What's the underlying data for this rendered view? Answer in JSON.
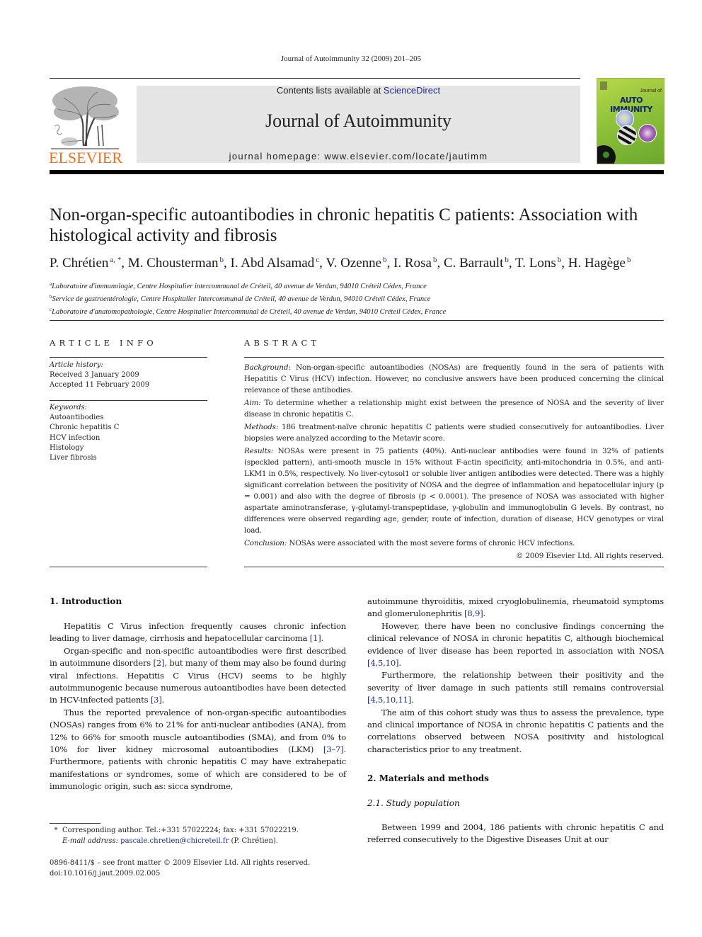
{
  "header": {
    "running_head": "Journal of Autoimmunity 32 (2009) 201–205",
    "contents_prefix": "Contents lists available at ",
    "contents_link": "ScienceDirect",
    "journal_name": "Journal of Autoimmunity",
    "homepage_prefix": "journal homepage: ",
    "homepage_url": "www.elsevier.com/locate/jautimm",
    "publisher_logo_text": "ELSEVIER",
    "cover": {
      "small_text": "Journal of",
      "big_text": "AUTO IMMUNITY"
    },
    "colors": {
      "elsevier_orange": "#f37021",
      "link_blue": "#1f2d8a",
      "gray_box": "#e5e5e5",
      "cover_green": "#8fc23a",
      "cover_title_blue": "#13226e"
    }
  },
  "article": {
    "title": "Non-organ-specific autoantibodies in chronic hepatitis C patients: Association with histological activity and fibrosis",
    "authors": [
      {
        "name": "P. Chrétien",
        "sup": "a, *"
      },
      {
        "name": "M. Chousterman",
        "sup": "b"
      },
      {
        "name": "I. Abd Alsamad",
        "sup": "c"
      },
      {
        "name": "V. Ozenne",
        "sup": "b"
      },
      {
        "name": "I. Rosa",
        "sup": "b"
      },
      {
        "name": "C. Barrault",
        "sup": "b"
      },
      {
        "name": "T. Lons",
        "sup": "b"
      },
      {
        "name": "H. Hagège",
        "sup": "b"
      }
    ],
    "affiliations": [
      {
        "key": "a",
        "text": "Laboratoire d'immunologie, Centre Hospitalier intercommunal de Créteil, 40 avenue de Verdun, 94010 Créteil Cédex, France"
      },
      {
        "key": "b",
        "text": "Service de gastroentérologie, Centre Hospitalier Intercommunal de Créteil, 40 avenue de Verdun, 94010 Créteil Cédex, France"
      },
      {
        "key": "c",
        "text": "Laboratoire d'anatomopathologie, Centre Hospitalier Intercommunal de Créteil, 40 avenue de Verdun, 94010 Créteil Cédex, France"
      }
    ]
  },
  "article_info": {
    "heading": "ARTICLE INFO",
    "history_label": "Article history:",
    "received": "Received 3 January 2009",
    "accepted": "Accepted 11 February 2009",
    "keywords_label": "Keywords:",
    "keywords": [
      "Autoantibodies",
      "Chronic hepatitis C",
      "HCV infection",
      "Histology",
      "Liver fibrosis"
    ]
  },
  "abstract": {
    "heading": "ABSTRACT",
    "sections": [
      {
        "label": "Background:",
        "text": " Non-organ-specific autoantibodies (NOSAs) are frequently found in the sera of patients with Hepatitis C Virus (HCV) infection. However, no conclusive answers have been produced concerning the clinical relevance of these antibodies."
      },
      {
        "label": "Aim:",
        "text": " To determine whether a relationship might exist between the presence of NOSA and the severity of liver disease in chronic hepatitis C."
      },
      {
        "label": "Methods:",
        "text": " 186 treatment-naïve chronic hepatitis C patients were studied consecutively for autoantibodies. Liver biopsies were analyzed according to the Metavir score."
      },
      {
        "label": "Results:",
        "text": " NOSAs were present in 75 patients (40%). Anti-nuclear antibodies were found in 32% of patients (speckled pattern), anti-smooth muscle in 15% without F-actin specificity, anti-mitochondria in 0.5%, and anti-LKM1 in 0.5%, respectively. No liver-cytosol1 or soluble liver antigen antibodies were detected. There was a highly significant correlation between the positivity of NOSA and the degree of inflammation and hepatocellular injury (p = 0.001) and also with the degree of fibrosis (p < 0.0001). The presence of NOSA was associated with higher aspartate aminotransferase, γ-glutamyl-transpeptidase, γ-globulin and immunoglobulin G levels. By contrast, no differences were observed regarding age, gender, route of infection, duration of disease, HCV genotypes or viral load."
      },
      {
        "label": "Conclusion:",
        "text": " NOSAs were associated with the most severe forms of chronic HCV infections."
      }
    ],
    "copyright": "© 2009 Elsevier Ltd. All rights reserved."
  },
  "body": {
    "intro_heading": "1.  Introduction",
    "intro_paragraphs": [
      {
        "parts": [
          {
            "t": "Hepatitis C Virus infection frequently causes chronic infection leading to liver damage, cirrhosis and hepatocellular carcinoma "
          },
          {
            "ref": "[1]"
          },
          {
            "t": "."
          }
        ]
      },
      {
        "parts": [
          {
            "t": "Organ-specific and non-specific autoantibodies were first described in autoimmune disorders "
          },
          {
            "ref": "[2]"
          },
          {
            "t": ", but many of them may also be found during viral infections. Hepatitis C Virus (HCV) seems to be highly autoimmunogenic because numerous autoantibodies have been detected in HCV-infected patients "
          },
          {
            "ref": "[3]"
          },
          {
            "t": "."
          }
        ]
      },
      {
        "parts": [
          {
            "t": "Thus the reported prevalence of non-organ-specific autoantibodies (NOSAs) ranges from 6% to 21% for anti-nuclear antibodies (ANA), from 12% to 66% for smooth muscle autoantibodies (SMA), and from 0% to 10% for liver kidney microsomal autoantibodies (LKM) "
          },
          {
            "ref": "[3–7]"
          },
          {
            "t": ". Furthermore, patients with chronic hepatitis C may have extrahepatic manifestations or syndromes, some of which are considered to be of immunologic origin, such as: sicca syndrome,"
          }
        ]
      }
    ],
    "right_paragraphs": [
      {
        "noindent": true,
        "parts": [
          {
            "t": "autoimmune thyroiditis, mixed cryoglobulinemia, rheumatoid symptoms and glomerulonephritis "
          },
          {
            "ref": "[8,9]"
          },
          {
            "t": "."
          }
        ]
      },
      {
        "parts": [
          {
            "t": "However, there have been no conclusive findings concerning the clinical relevance of NOSA in chronic hepatitis C, although biochemical evidence of liver disease has been reported in association with NOSA "
          },
          {
            "ref": "[4,5,10]"
          },
          {
            "t": "."
          }
        ]
      },
      {
        "parts": [
          {
            "t": "Furthermore, the relationship between their positivity and the severity of liver damage in such patients still remains controversial "
          },
          {
            "ref": "[4,5,10,11]"
          },
          {
            "t": "."
          }
        ]
      },
      {
        "parts": [
          {
            "t": "The aim of this cohort study was thus to assess the prevalence, type and clinical importance of NOSA in chronic hepatitis C patients and the correlations observed between NOSA positivity and histological characteristics prior to any treatment."
          }
        ]
      }
    ],
    "methods_heading": "2.  Materials and methods",
    "study_pop_heading": "2.1.  Study population",
    "study_pop_paragraph": "Between 1999 and 2004, 186 patients with chronic hepatitis C and referred consecutively to the Digestive Diseases Unit at our"
  },
  "footnote": {
    "star": "*",
    "corresponding": "Corresponding author. Tel.:+331 57022224; fax: +331 57022219.",
    "email_label": "E-mail address:",
    "email": "pascale.chretien@chicreteil.fr",
    "email_suffix": " (P. Chrétien).",
    "front_matter": "0896-8411/$ – see front matter © 2009 Elsevier Ltd. All rights reserved.",
    "doi": "doi:10.1016/j.jaut.2009.02.005"
  }
}
